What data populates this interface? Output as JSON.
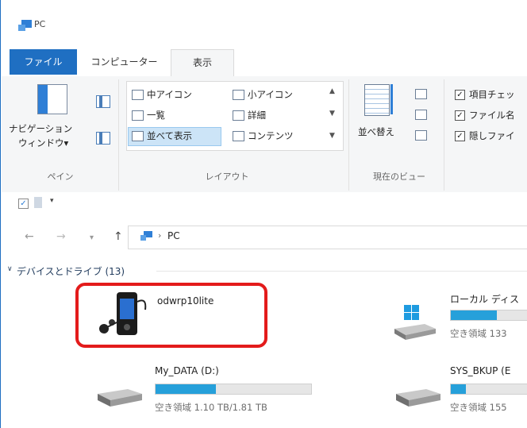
{
  "window": {
    "title": "PC"
  },
  "tabs": {
    "file": "ファイル",
    "computer": "コンピューター",
    "view": "表示"
  },
  "ribbon": {
    "pane": {
      "nav_pane_line1": "ナビゲーション",
      "nav_pane_line2": "ウィンドウ▾",
      "group_label": "ペイン"
    },
    "layout": {
      "items": [
        "中アイコン",
        "小アイコン",
        "一覧",
        "詳細",
        "並べて表示",
        "コンテンツ"
      ],
      "selected": "並べて表示",
      "group_label": "レイアウト"
    },
    "current_view": {
      "sort_label": "並べ替え",
      "group_label": "現在のビュー"
    },
    "show_hide": {
      "checkboxes": [
        {
          "label": "項目チェッ",
          "checked": true
        },
        {
          "label": "ファイル名",
          "checked": true
        },
        {
          "label": "隠しファイ",
          "checked": true
        }
      ]
    }
  },
  "address": {
    "location": "PC"
  },
  "section": {
    "header": "デバイスとドライブ (13)"
  },
  "devices": [
    {
      "name": "odwrp10lite"
    }
  ],
  "drives": [
    {
      "name": "ローカル ディス",
      "free_text": "空き領域 133",
      "used_fraction": 0.6
    },
    {
      "name": "My_DATA (D:)",
      "free_text": "空き領域 1.10 TB/1.81 TB",
      "used_fraction": 0.39
    },
    {
      "name": "SYS_BKUP (E",
      "free_text": "空き領域 155",
      "used_fraction": 0.2
    }
  ],
  "colors": {
    "accent": "#1f6fc2",
    "drive_fill": "#26a0da",
    "highlight": "#e31b1b"
  }
}
